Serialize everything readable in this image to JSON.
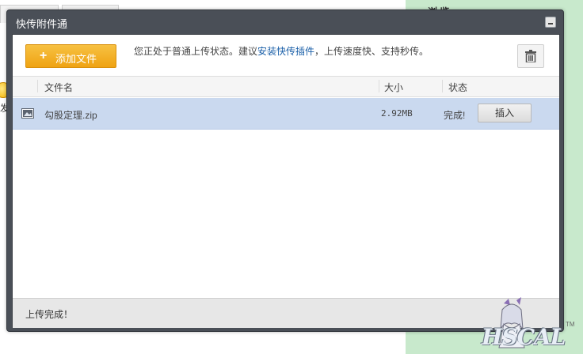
{
  "background": {
    "side_text": "发",
    "top_right_text": "浏 览"
  },
  "dialog": {
    "title": "快传附件通",
    "toolbar": {
      "add_file_label": "添加文件",
      "tip_prefix": "您正处于普通上传状态。建议",
      "tip_link": "安装快传插件",
      "tip_suffix": "，上传速度快、支持秒传。"
    },
    "table": {
      "columns": [
        "文件名",
        "大小",
        "状态"
      ],
      "rows": [
        {
          "name": "勾股定理.zip",
          "size": "2.92MB",
          "status": "完成!",
          "action": "插入"
        }
      ]
    },
    "footer_message": "上传完成！"
  },
  "watermark": {
    "text": "HSCAL",
    "small": "TM"
  },
  "colors": {
    "dialog_frame": "#4a4f57",
    "add_button": "#f0a818",
    "selected_row": "#cad9ef",
    "link": "#1a5fa8",
    "page_green": "#c8e9cc"
  }
}
